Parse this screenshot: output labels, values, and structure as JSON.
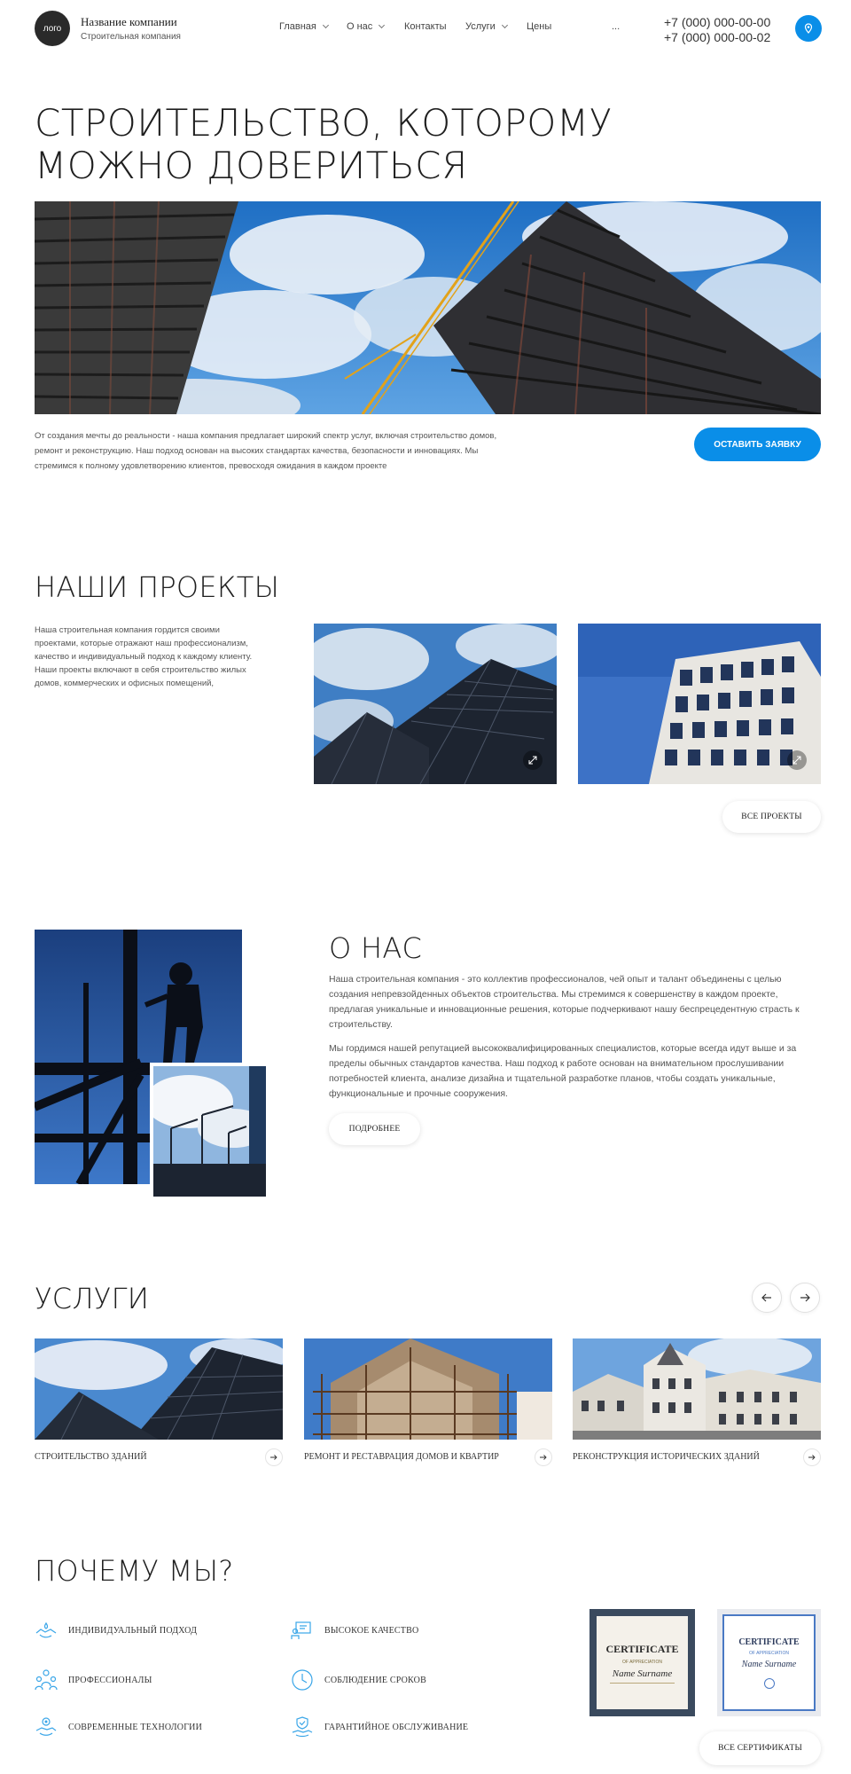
{
  "header": {
    "logo_text": "лого",
    "company_name": "Название компании",
    "company_subtitle": "Строительная компания",
    "nav": [
      {
        "label": "Главная",
        "has_dropdown": true
      },
      {
        "label": "О нас",
        "has_dropdown": true
      },
      {
        "label": "Контакты",
        "has_dropdown": false
      },
      {
        "label": "Услуги",
        "has_dropdown": true
      },
      {
        "label": "Цены",
        "has_dropdown": false
      },
      {
        "label": "...",
        "has_dropdown": false
      }
    ],
    "phones": [
      "+7 (000) 000-00-00",
      "+7 (000) 000-00-02"
    ],
    "accent_color": "#0a8ee8"
  },
  "hero": {
    "title": "СТРОИТЕЛЬСТВО, КОТОРОМУ МОЖНО ДОВЕРИТЬСЯ",
    "text": "От создания мечты до реальности - наша компания предлагает широкий спектр услуг, включая строительство домов, ремонт и реконструкцию. Наш подход основан на высоких стандартах качества, безопасности и инновациях. Мы стремимся к полному удовлетворению клиентов, превосходя ожидания в каждом проекте",
    "button": "ОСТАВИТЬ ЗАЯВКУ"
  },
  "projects": {
    "title": "НАШИ ПРОЕКТЫ",
    "text": "Наша строительная компания гордится своими проектами, которые отражают наш профессионализм, качество и индивидуальный подход к каждому клиенту. Наши проекты включают в себя строительство жилых домов, коммерческих и офисных помещений,",
    "button": "ВСЕ ПРОЕКТЫ"
  },
  "about": {
    "title": "О НАС",
    "paragraph1": "Наша строительная компания - это коллектив профессионалов, чей опыт и талант объединены с целью создания непревзойденных объектов строительства. Мы стремимся к совершенству в каждом проекте, предлагая уникальные и инновационные решения, которые подчеркивают нашу беспрецедентную страсть к строительству.",
    "paragraph2": "Мы гордимся нашей репутацией высококвалифицированных специалистов, которые всегда идут выше и за пределы обычных стандартов качества. Наш подход к работе основан на внимательном прослушивании потребностей клиента, анализе дизайна и тщательной разработке планов, чтобы создать уникальные, функциональные и прочные сооружения.",
    "button": "ПОДРОБНЕЕ"
  },
  "services": {
    "title": "УСЛУГИ",
    "items": [
      {
        "label": "СТРОИТЕЛЬСТВО ЗДАНИЙ"
      },
      {
        "label": "РЕМОНТ И РЕСТАВРАЦИЯ ДОМОВ И КВАРТИР"
      },
      {
        "label": "РЕКОНСТРУКЦИЯ ИСТОРИЧЕСКИХ ЗДАНИЙ"
      }
    ]
  },
  "why": {
    "title": "ПОЧЕМУ МЫ?",
    "items": [
      {
        "label": "ИНДИВИДУАЛЬНЫЙ ПОДХОД",
        "icon": "handshake-icon"
      },
      {
        "label": "ВЫСОКОЕ КАЧЕСТВО",
        "icon": "quality-board-icon"
      },
      {
        "label": "ПРОФЕССИОНАЛЫ",
        "icon": "team-icon"
      },
      {
        "label": "СОБЛЮДЕНИЕ СРОКОВ",
        "icon": "clock-icon"
      },
      {
        "label": "СОВРЕМЕННЫЕ ТЕХНОЛОГИИ",
        "icon": "tech-hand-icon"
      },
      {
        "label": "ГАРАНТИЙНОЕ ОБСЛУЖИВАНИЕ",
        "icon": "shield-hand-icon"
      }
    ],
    "certificates": [
      {
        "title": "CERTIFICATE",
        "subtitle": "OF APPRECIATION",
        "name": "Name Surname"
      },
      {
        "title": "CERTIFICATE",
        "subtitle": "OF APPRECIATION",
        "name": "Name Surname"
      }
    ],
    "button": "ВСЕ СЕРТИФИКАТЫ"
  }
}
